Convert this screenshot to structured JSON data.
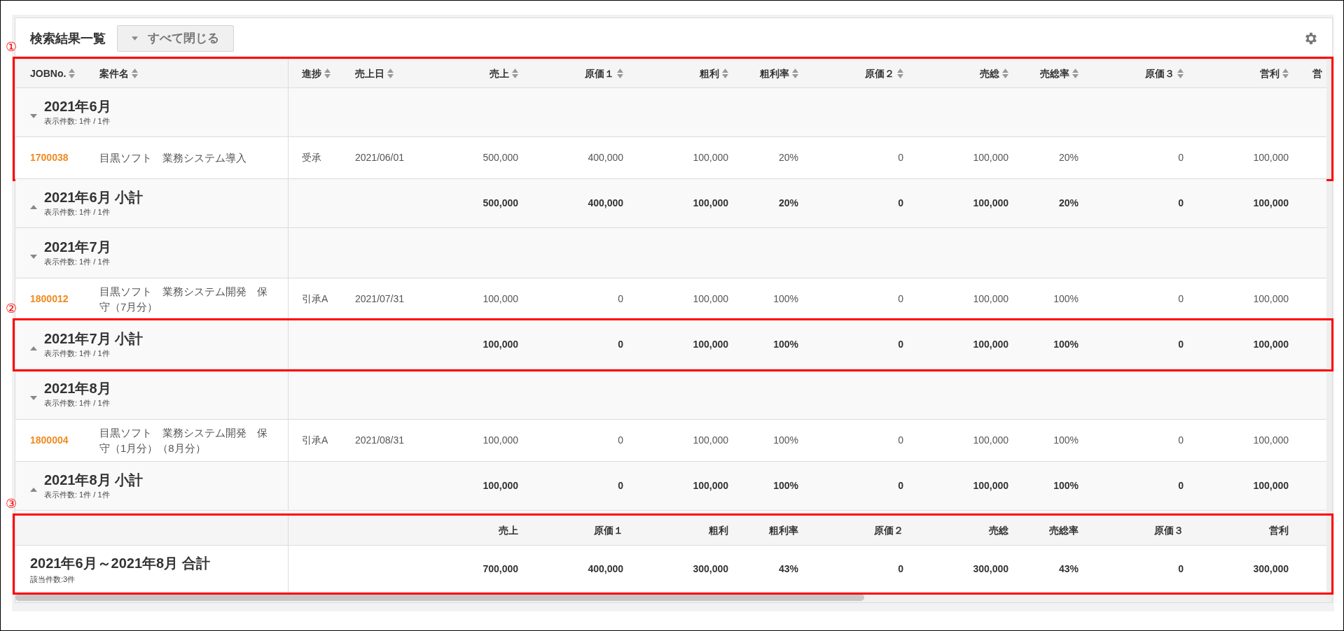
{
  "header": {
    "title": "検索結果一覧",
    "collapse_button": {
      "label": "すべて閉じる"
    }
  },
  "table": {
    "annotation": "①",
    "columns": [
      "JOBNo.",
      "案件名",
      "進捗",
      "売上日",
      "売上",
      "原価１",
      "粗利",
      "粗利率",
      "原価２",
      "売総",
      "売総率",
      "原価３",
      "営利",
      "営"
    ],
    "groups": [
      {
        "title": "2021年6月",
        "count": "表示件数: 1件 / 1件",
        "expanded": true,
        "rows": [
          {
            "cells": [
              "1700038",
              "目黒ソフト　業務システム導入",
              "受承",
              "2021/06/01",
              "500,000",
              "400,000",
              "100,000",
              "20%",
              "0",
              "100,000",
              "20%",
              "0",
              "100,000"
            ]
          }
        ],
        "subtotal": {
          "title": "2021年6月 小計",
          "count": "表示件数: 1件 / 1件",
          "values": [
            "500,000",
            "400,000",
            "100,000",
            "20%",
            "0",
            "100,000",
            "20%",
            "0",
            "100,000"
          ]
        }
      },
      {
        "title": "2021年7月",
        "count": "表示件数: 1件 / 1件",
        "expanded": true,
        "rows": [
          {
            "cells": [
              "1800012",
              "目黒ソフト　業務システム開発　保守（7月分）",
              "引承A",
              "2021/07/31",
              "100,000",
              "0",
              "100,000",
              "100%",
              "0",
              "100,000",
              "100%",
              "0",
              "100,000"
            ]
          }
        ],
        "subtotal": {
          "annotation": "②",
          "title": "2021年7月 小計",
          "count": "表示件数: 1件 / 1件",
          "values": [
            "100,000",
            "0",
            "100,000",
            "100%",
            "0",
            "100,000",
            "100%",
            "0",
            "100,000"
          ]
        }
      },
      {
        "title": "2021年8月",
        "count": "表示件数: 1件 / 1件",
        "expanded": true,
        "rows": [
          {
            "cells": [
              "1800004",
              "目黒ソフト　業務システム開発　保守（1月分）（8月分）",
              "引承A",
              "2021/08/31",
              "100,000",
              "0",
              "100,000",
              "100%",
              "0",
              "100,000",
              "100%",
              "0",
              "100,000"
            ]
          }
        ],
        "subtotal": {
          "title": "2021年8月 小計",
          "count": "表示件数: 1件 / 1件",
          "values": [
            "100,000",
            "0",
            "100,000",
            "100%",
            "0",
            "100,000",
            "100%",
            "0",
            "100,000"
          ]
        }
      }
    ]
  },
  "total": {
    "annotation": "③",
    "columns": [
      "売上",
      "原価１",
      "粗利",
      "粗利率",
      "原価２",
      "売総",
      "売総率",
      "原価３",
      "営利"
    ],
    "title": "2021年6月～2021年8月  合計",
    "count": "該当件数:3件",
    "values": [
      "700,000",
      "400,000",
      "300,000",
      "43%",
      "0",
      "300,000",
      "43%",
      "0",
      "300,000"
    ]
  }
}
